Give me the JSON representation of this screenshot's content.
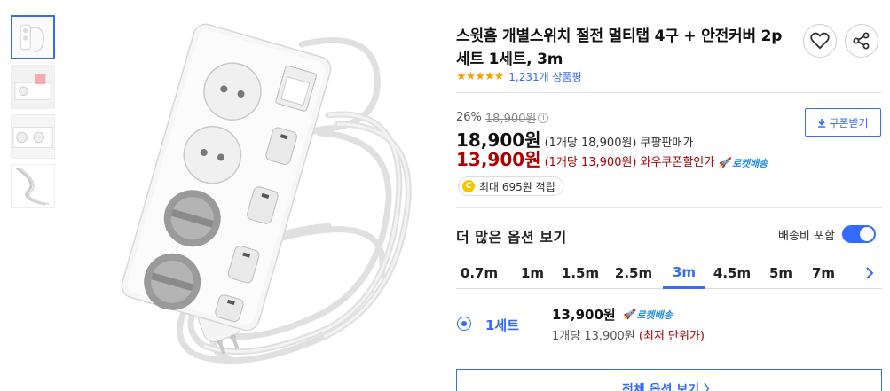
{
  "thumbnails": [
    {
      "label": "thumbnail-1"
    },
    {
      "label": "thumbnail-2"
    },
    {
      "label": "thumbnail-3"
    },
    {
      "label": "thumbnail-4"
    }
  ],
  "product": {
    "title": "스윗홈 개별스위치 절전 멀티탭 4구 + 안전커버 2p 세트 1세트, 3m",
    "rating_stars": "★★★★★",
    "review_count": "1,231개 상품평"
  },
  "pricing": {
    "discount": "26%",
    "original_price": "18,900원",
    "coupon_button": "쿠폰받기",
    "price": "18,900원",
    "price_detail": "(1개당 18,900원)",
    "price_label": "쿠팡판매가",
    "wow_price": "13,900원",
    "wow_detail": "(1개당 13,900원)",
    "wow_label": "와우쿠폰할인가",
    "rocket_label": "로켓배송",
    "reward_coin": "C",
    "reward_text": "최대 695원 적립"
  },
  "options": {
    "more_title": "더 많은 옵션 보기",
    "shipping_toggle_label": "배송비 포함",
    "shipping_toggle_on": true,
    "tabs": [
      "0.7m",
      "1m",
      "1.5m",
      "2.5m",
      "3m",
      "4.5m",
      "5m",
      "7m"
    ],
    "selected_tab": "3m",
    "item": {
      "name": "1세트",
      "price": "13,900원",
      "rocket_label": "로켓배송",
      "unit_price": "1개당 13,900원",
      "lowest": "(최저 단위가)"
    },
    "all_options_button": "전체 옵션 보기 〉"
  },
  "colors": {
    "accent": "#346aff",
    "sale_red": "#ae0000",
    "star": "#f5a100"
  }
}
